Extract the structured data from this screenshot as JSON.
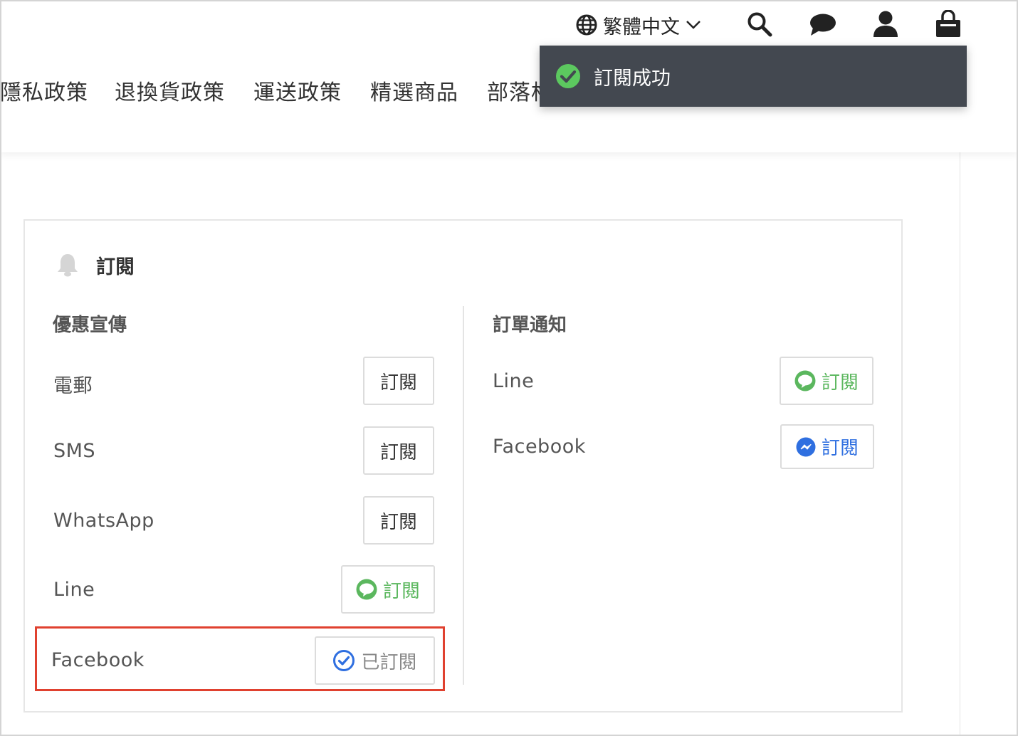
{
  "header": {
    "language": "繁體中文",
    "nav": [
      "隱私政策",
      "退換貨政策",
      "運送政策",
      "精選商品",
      "部落格首頁"
    ],
    "icons": [
      "globe-icon",
      "chevron-down-icon",
      "search-icon",
      "chat-icon",
      "user-icon",
      "shopping-bag-icon"
    ]
  },
  "toast": {
    "message": "訂閱成功",
    "icon": "check-circle-icon",
    "color": "#434850"
  },
  "subscription": {
    "title": "訂閱",
    "promotions": {
      "heading": "優惠宣傳",
      "rows": [
        {
          "label": "電郵",
          "button": "訂閱"
        },
        {
          "label": "SMS",
          "button": "訂閱"
        },
        {
          "label": "WhatsApp",
          "button": "訂閱"
        },
        {
          "label": "Line",
          "button": "訂閱"
        },
        {
          "label": "Facebook",
          "button": "已訂閱"
        }
      ]
    },
    "order_notifications": {
      "heading": "訂單通知",
      "rows": [
        {
          "label": "Line",
          "button": "訂閱"
        },
        {
          "label": "Facebook",
          "button": "訂閱"
        }
      ]
    }
  },
  "colors": {
    "line_green": "#5bb75e",
    "messenger_blue": "#2f6fe0",
    "highlight_red": "#e0412f"
  }
}
